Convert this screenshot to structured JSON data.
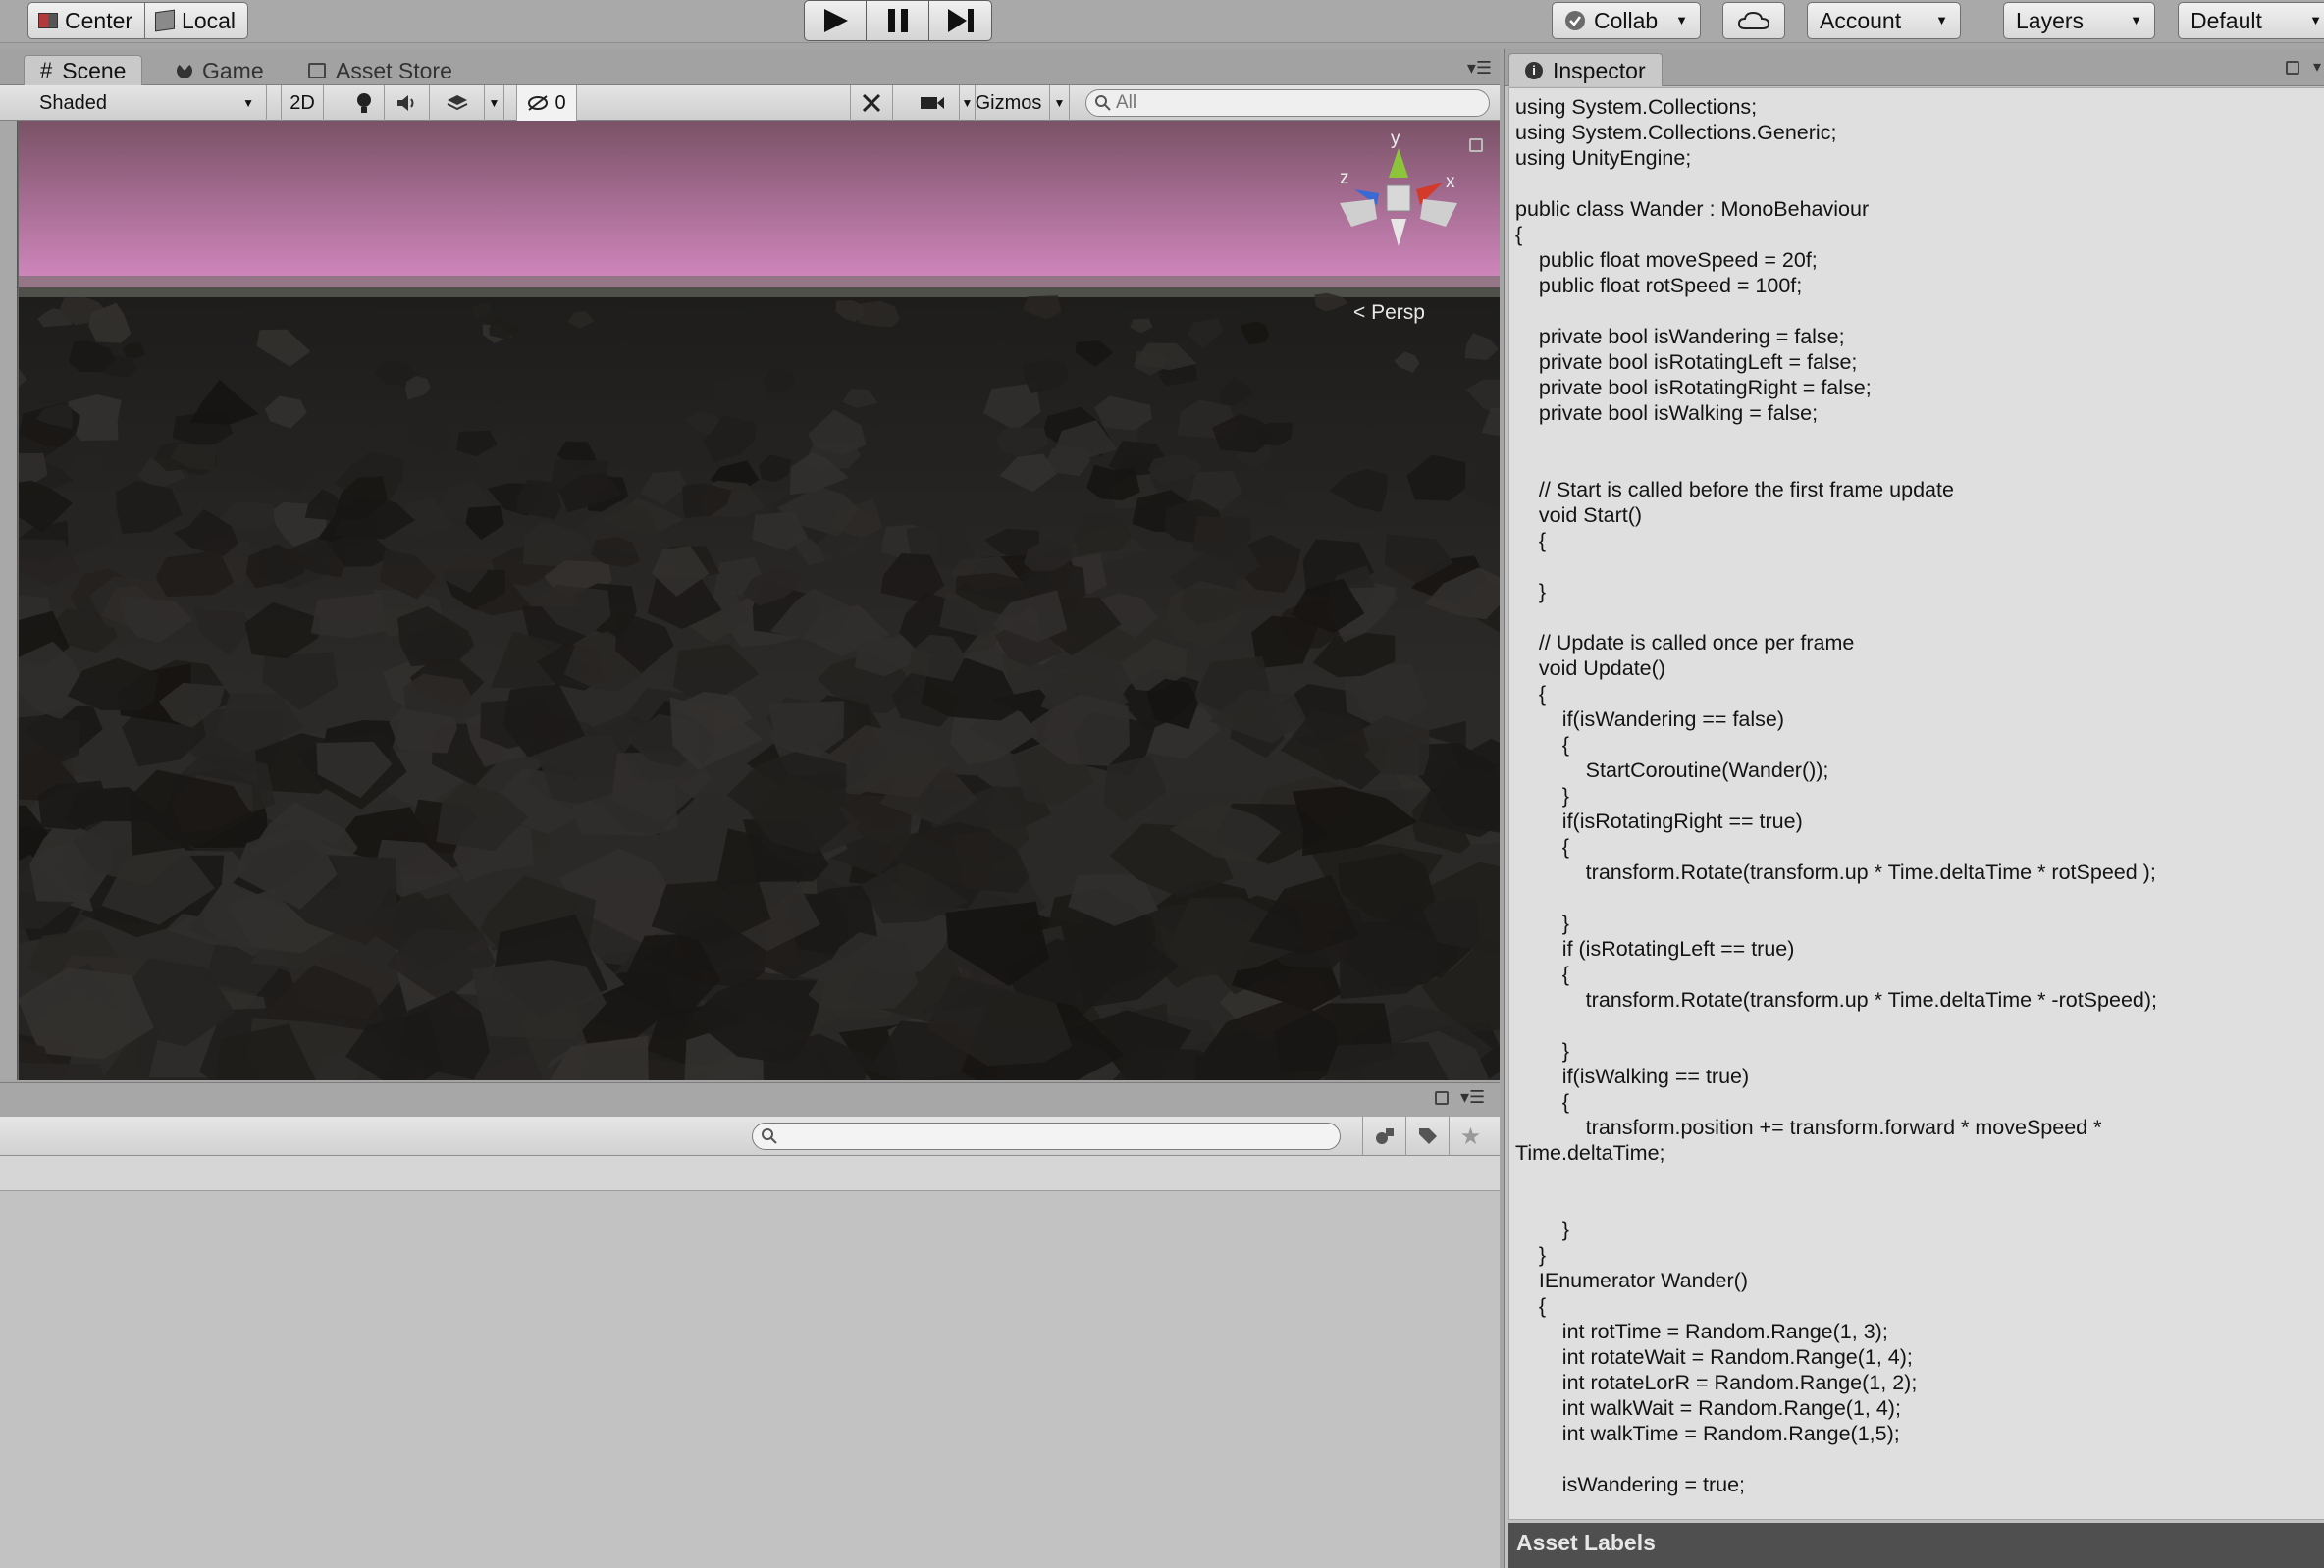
{
  "toolbar": {
    "pivot_center_label": "Center",
    "pivot_local_label": "Local",
    "collab_label": "Collab",
    "account_label": "Account",
    "layers_label": "Layers",
    "layout_label": "Default",
    "icons": [
      "play-icon",
      "pause-icon",
      "step-icon",
      "cloud-icon",
      "check-icon"
    ]
  },
  "scene_tabs": [
    {
      "label": "Scene",
      "icon": "grid-icon",
      "active": true
    },
    {
      "label": "Game",
      "icon": "pacman-icon",
      "active": false
    },
    {
      "label": "Asset Store",
      "icon": "bag-icon",
      "active": false
    }
  ],
  "scene_toolbar": {
    "draw_mode": "Shaded",
    "mode_2d": "2D",
    "hidden_count": "0",
    "gizmos_label": "Gizmos",
    "search_placeholder": "All"
  },
  "scene_view": {
    "projection_label": "Persp",
    "axis_x": "x",
    "axis_y": "y",
    "axis_z": "z",
    "colors": {
      "sky_top": "#7a5266",
      "sky_horizon": "#d489c1",
      "ground": "#2a2826"
    }
  },
  "inspector": {
    "tab_label": "Inspector",
    "asset_labels": "Asset Labels",
    "code": "using System.Collections;\nusing System.Collections.Generic;\nusing UnityEngine;\n\npublic class Wander : MonoBehaviour\n{\n    public float moveSpeed = 20f;\n    public float rotSpeed = 100f;\n\n    private bool isWandering = false;\n    private bool isRotatingLeft = false;\n    private bool isRotatingRight = false;\n    private bool isWalking = false;\n\n\n    // Start is called before the first frame update\n    void Start()\n    {\n\n    }\n\n    // Update is called once per frame\n    void Update()\n    {\n        if(isWandering == false)\n        {\n            StartCoroutine(Wander());\n        }\n        if(isRotatingRight == true)\n        {\n            transform.Rotate(transform.up * Time.deltaTime * rotSpeed );\n\n        }\n        if (isRotatingLeft == true)\n        {\n            transform.Rotate(transform.up * Time.deltaTime * -rotSpeed);\n\n        }\n        if(isWalking == true)\n        {\n            transform.position += transform.forward * moveSpeed *\nTime.deltaTime;\n\n\n        }\n    }\n    IEnumerator Wander()\n    {\n        int rotTime = Random.Range(1, 3);\n        int rotateWait = Random.Range(1, 4);\n        int rotateLorR = Random.Range(1, 2);\n        int walkWait = Random.Range(1, 4);\n        int walkTime = Random.Range(1,5);\n\n        isWandering = true;"
  }
}
